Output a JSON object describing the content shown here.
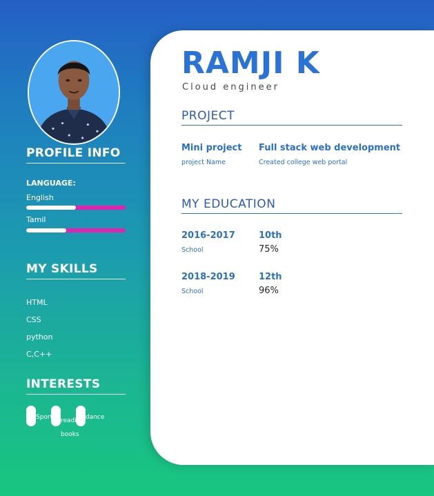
{
  "profile": {
    "name": "RAMJI K",
    "role": "Cloud engineer"
  },
  "sidebar": {
    "profile_info_title": "PROFILE INFO",
    "language_title": "LANGUAGE:",
    "languages": [
      {
        "name": "English",
        "level_percent": 50
      },
      {
        "name": "Tamil",
        "level_percent": 40
      }
    ],
    "skills_title": "MY SKILLS",
    "skills": [
      "HTML",
      "CSS",
      "python",
      "C,C++"
    ],
    "interests_title": "INTERESTS",
    "interests": [
      "Sports",
      "reading books",
      "dance"
    ]
  },
  "project": {
    "title": "PROJECT",
    "name": "Mini project",
    "name_label": "project Name",
    "detail": "Full stack web development",
    "detail_desc": "Created college web portal"
  },
  "education": {
    "title": "MY EDUCATION",
    "entries": [
      {
        "years": "2016-2017",
        "institution": "School",
        "grade": "10th",
        "score": "75%"
      },
      {
        "years": "2018-2019",
        "institution": "School",
        "grade": "12th",
        "score": "96%"
      }
    ]
  },
  "colors": {
    "accent": "#2b72d6",
    "bar_fill": "#ffffff",
    "bar_track": "#e223b0"
  },
  "icons": {
    "avatar": "person-photo"
  }
}
